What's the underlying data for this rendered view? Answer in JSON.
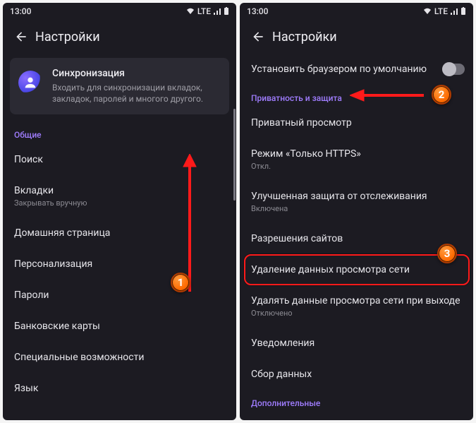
{
  "status": {
    "time": "13:00",
    "net": "LTE"
  },
  "header": {
    "title": "Настройки"
  },
  "left": {
    "sync_card": {
      "title": "Синхронизация",
      "subtitle": "Входить для синхронизации вкладок, закладок, паролей и многого другого."
    },
    "section_general": "Общие",
    "items": {
      "search": "Поиск",
      "tabs": "Вкладки",
      "tabs_sub": "Закрывать вручную",
      "home": "Домашняя страница",
      "personalization": "Персонализация",
      "passwords": "Пароли",
      "cards": "Банковские карты",
      "accessibility": "Специальные возможности",
      "language": "Язык"
    }
  },
  "right": {
    "set_default": "Установить браузером по умолчанию",
    "section_privacy": "Приватность и защита",
    "items": {
      "private_browsing": "Приватный просмотр",
      "https_only": "Режим «Только HTTPS»",
      "https_only_sub": "Откл.",
      "tracking": "Улучшенная защита от отслеживания",
      "tracking_sub": "Включена",
      "site_perms": "Разрешения сайтов",
      "clear_data": "Удаление данных просмотра сети",
      "clear_on_exit": "Удалять данные просмотра сети при выходе",
      "clear_on_exit_sub": "Отключено",
      "notifications": "Уведомления",
      "data_collection": "Сбор данных"
    },
    "section_additional": "Дополнительные"
  },
  "badges": {
    "one": "1",
    "two": "2",
    "three": "3"
  }
}
